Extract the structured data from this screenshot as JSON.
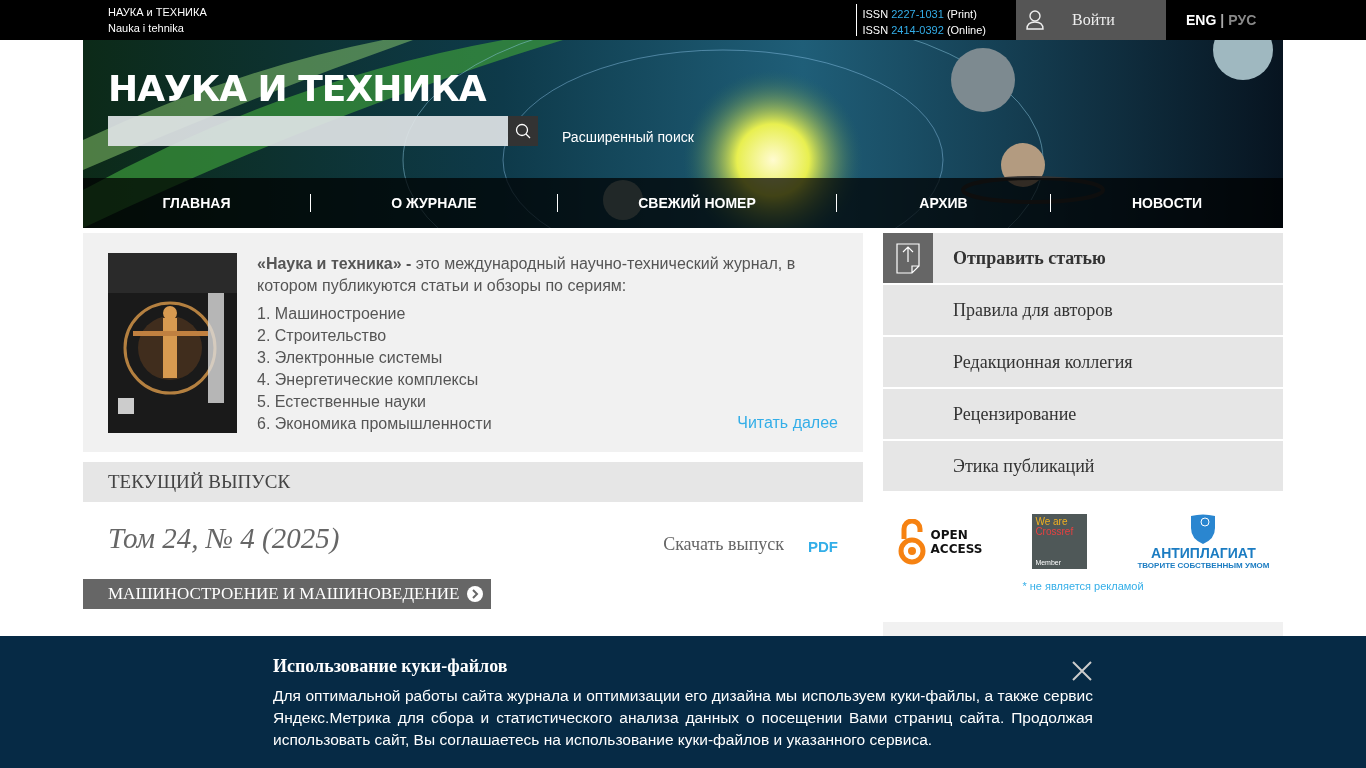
{
  "top_bar": {
    "site_name": "НАУКА и ТЕХНИКА",
    "site_name_latin": "Nauka i tehnika",
    "issn": [
      {
        "prefix": "ISSN",
        "number": "2227-1031",
        "suffix": "(Print)"
      },
      {
        "prefix": "ISSN",
        "number": "2414-0392",
        "suffix": "(Online)"
      }
    ],
    "login": "Войти",
    "languages": [
      {
        "label": "ENG",
        "selected": true
      },
      {
        "label": "РУС",
        "selected": false
      }
    ],
    "separator": "|"
  },
  "header": {
    "title": "НАУКА И ТЕХНИКА",
    "advanced_search": "Расширенный поиск"
  },
  "nav": [
    "ГЛАВНАЯ",
    "О ЖУРНАЛЕ",
    "СВЕЖИЙ НОМЕР",
    "АРХИВ",
    "НОВОСТИ"
  ],
  "about": {
    "intro": "**«Наука и техника» -** это международный научно-технический журнал, в котором публикуются статьи и обзоры по сериям:",
    "series": [
      "1. Машиностроение",
      "2. Строительство",
      "3. Электронные системы",
      "4. Энергетические комплексы",
      "5. Естественные науки",
      "6. Экономика промышленности"
    ],
    "read_more": "Читать далее"
  },
  "current_issue": {
    "heading": "ТЕКУЩИЙ ВЫПУСК",
    "volume": "Том 24, № 4 (2025)",
    "download": "Скачать выпуск",
    "pdf": "PDF",
    "section": "МАШИНОСТРОЕНИЕ И МАШИНОВЕДЕНИЕ"
  },
  "sidebar": {
    "items": [
      {
        "label": "Отправить статью",
        "kind": "primary"
      },
      {
        "label": "Правила для авторов",
        "kind": "plain"
      },
      {
        "label": "Редакционная коллегия",
        "kind": "plain"
      },
      {
        "label": "Рецензирование",
        "kind": "plain"
      },
      {
        "label": "Этика публикаций",
        "kind": "plain"
      }
    ],
    "logos": {
      "open_access": [
        "OPEN",
        "ACCESS"
      ],
      "crossref": [
        "We are",
        "Crossref",
        "Member"
      ],
      "antiplagiat": [
        "АНТИПЛАГИАТ",
        "ТВОРИТЕ СОБСТВЕННЫМ УМОМ"
      ]
    },
    "disclaimer": "* не является рекламой"
  },
  "cookie_banner": {
    "title": "Использование куки-файлов",
    "text": "Для оптимальной работы сайта журнала и оптимизации его дизайна мы используем куки-файлы, а также сервис Яндекс.Метрика для сбора и статистического анализа данных о посещении Вами страниц сайта. Продолжая использовать сайт, Вы соглашаетесь на использование куки-файлов и указанного сервиса."
  }
}
